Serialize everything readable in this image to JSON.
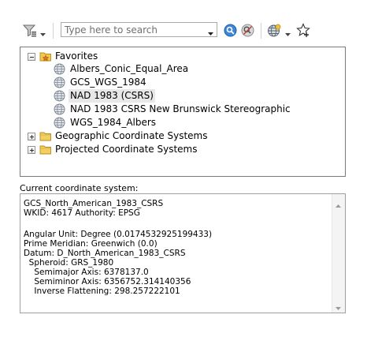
{
  "search": {
    "placeholder": "Type here to search"
  },
  "tree": {
    "favorites": {
      "label": "Favorites",
      "items": [
        {
          "label": "Albers_Conic_Equal_Area"
        },
        {
          "label": "GCS_WGS_1984"
        },
        {
          "label": "NAD 1983 (CSRS)"
        },
        {
          "label": "NAD 1983 CSRS New Brunswick Stereographic"
        },
        {
          "label": "WGS_1984_Albers"
        }
      ]
    },
    "geographic": {
      "label": "Geographic Coordinate Systems"
    },
    "projected": {
      "label": "Projected Coordinate Systems"
    }
  },
  "current": {
    "section_label": "Current coordinate system:",
    "lines": [
      "GCS_North_American_1983_CSRS",
      "WKID: 4617 Authority: EPSG",
      "",
      "Angular Unit: Degree (0.0174532925199433)",
      "Prime Meridian: Greenwich (0.0)",
      "Datum: D_North_American_1983_CSRS",
      "  Spheroid: GRS_1980",
      "    Semimajor Axis: 6378137.0",
      "    Semiminor Axis: 6356752.314140356",
      "    Inverse Flattening: 298.257222101"
    ]
  },
  "colors": {
    "accent_blue": "#2a6fc9",
    "folder_yellow": "#f2c94c",
    "globe_gray": "#8c97a3"
  }
}
